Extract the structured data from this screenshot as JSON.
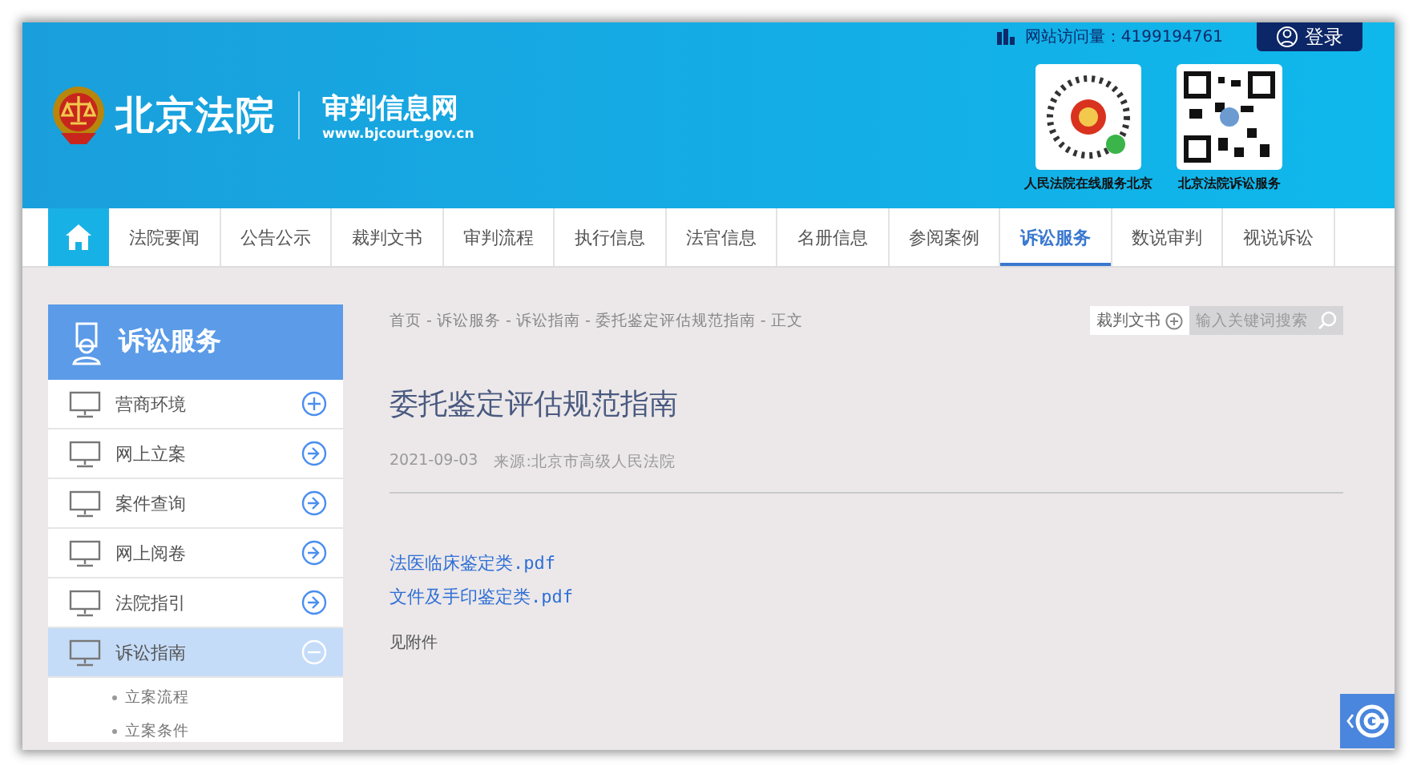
{
  "header": {
    "court_name": "北京法院",
    "site_name": "审判信息网",
    "site_url": "www.bjcourt.gov.cn",
    "visits": "网站访问量：4199194761",
    "login": "登录",
    "qr_codes": [
      {
        "label": "人民法院在线服务北京"
      },
      {
        "label": "北京法院诉讼服务"
      }
    ]
  },
  "nav": {
    "items": [
      {
        "label": "法院要闻",
        "selected": false
      },
      {
        "label": "公告公示",
        "selected": false
      },
      {
        "label": "裁判文书",
        "selected": false
      },
      {
        "label": "审判流程",
        "selected": false
      },
      {
        "label": "执行信息",
        "selected": false
      },
      {
        "label": "法官信息",
        "selected": false
      },
      {
        "label": "名册信息",
        "selected": false
      },
      {
        "label": "参阅案例",
        "selected": false
      },
      {
        "label": "诉讼服务",
        "selected": true
      },
      {
        "label": "数说审判",
        "selected": false
      },
      {
        "label": "视说诉讼",
        "selected": false
      }
    ]
  },
  "sidebar": {
    "title": "诉讼服务",
    "items": [
      {
        "label": "营商环境",
        "kind": "group",
        "expanded": false,
        "selected": false
      },
      {
        "label": "网上立案",
        "kind": "link",
        "expanded": false,
        "selected": false
      },
      {
        "label": "案件查询",
        "kind": "link",
        "expanded": false,
        "selected": false
      },
      {
        "label": "网上阅卷",
        "kind": "link",
        "expanded": false,
        "selected": false
      },
      {
        "label": "法院指引",
        "kind": "link",
        "expanded": false,
        "selected": false
      },
      {
        "label": "诉讼指南",
        "kind": "group",
        "expanded": true,
        "selected": true,
        "children": [
          {
            "label": "立案流程"
          },
          {
            "label": "立案条件"
          }
        ]
      }
    ]
  },
  "breadcrumb": "首页 - 诉讼服务 - 诉讼指南 - 委托鉴定评估规范指南 - 正文",
  "search": {
    "category": "裁判文书",
    "placeholder": "输入关键词搜索"
  },
  "article": {
    "title": "委托鉴定评估规范指南",
    "date": "2021-09-03",
    "source": "来源:北京市高级人民法院",
    "attachments": [
      "法医临床鉴定类.pdf",
      "文件及手印鉴定类.pdf"
    ],
    "body": "见附件"
  }
}
